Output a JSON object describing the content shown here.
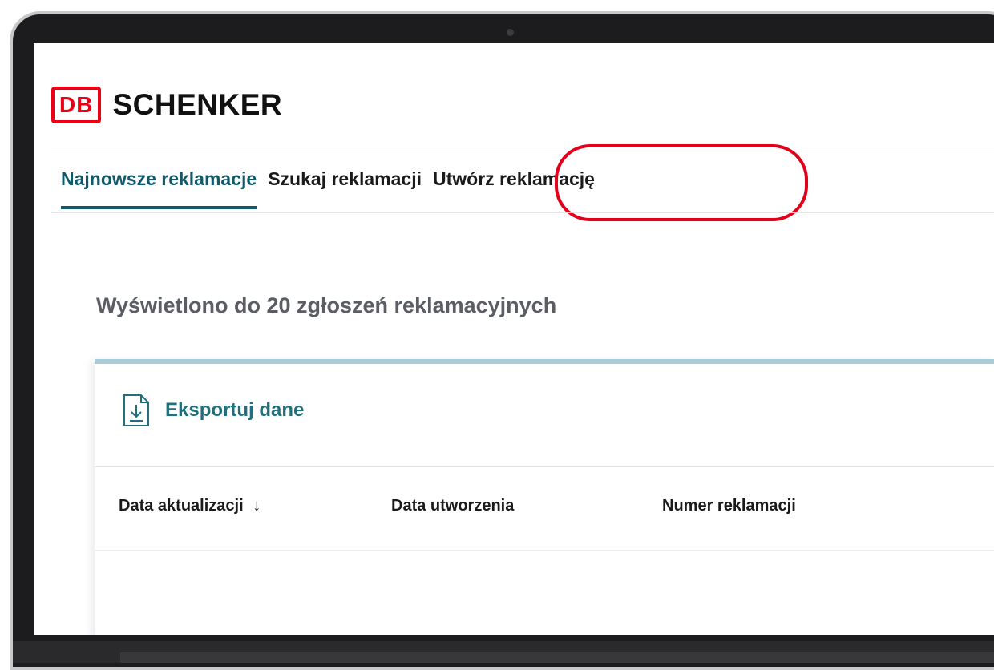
{
  "brand": {
    "db_mark": "DB",
    "name": "SCHENKER",
    "accent_color": "#ec0016"
  },
  "nav": {
    "tabs": [
      {
        "label": "Najnowsze reklamacje",
        "active": true
      },
      {
        "label": "Szukaj reklamacji",
        "active": false
      },
      {
        "label": "Utwórz reklamację",
        "active": false,
        "highlighted": true
      }
    ],
    "active_color": "#0d5a6c",
    "highlight_color": "#e3001b"
  },
  "summary": {
    "text": "Wyświetlono do 20 zgłoszeń reklamacyjnych"
  },
  "table": {
    "export_label": "Eksportuj dane",
    "export_icon": "file-download-icon",
    "columns": [
      {
        "label": "Data aktualizacji",
        "sort": "↓"
      },
      {
        "label": "Data utworzenia"
      },
      {
        "label": "Numer reklamacji"
      }
    ]
  }
}
